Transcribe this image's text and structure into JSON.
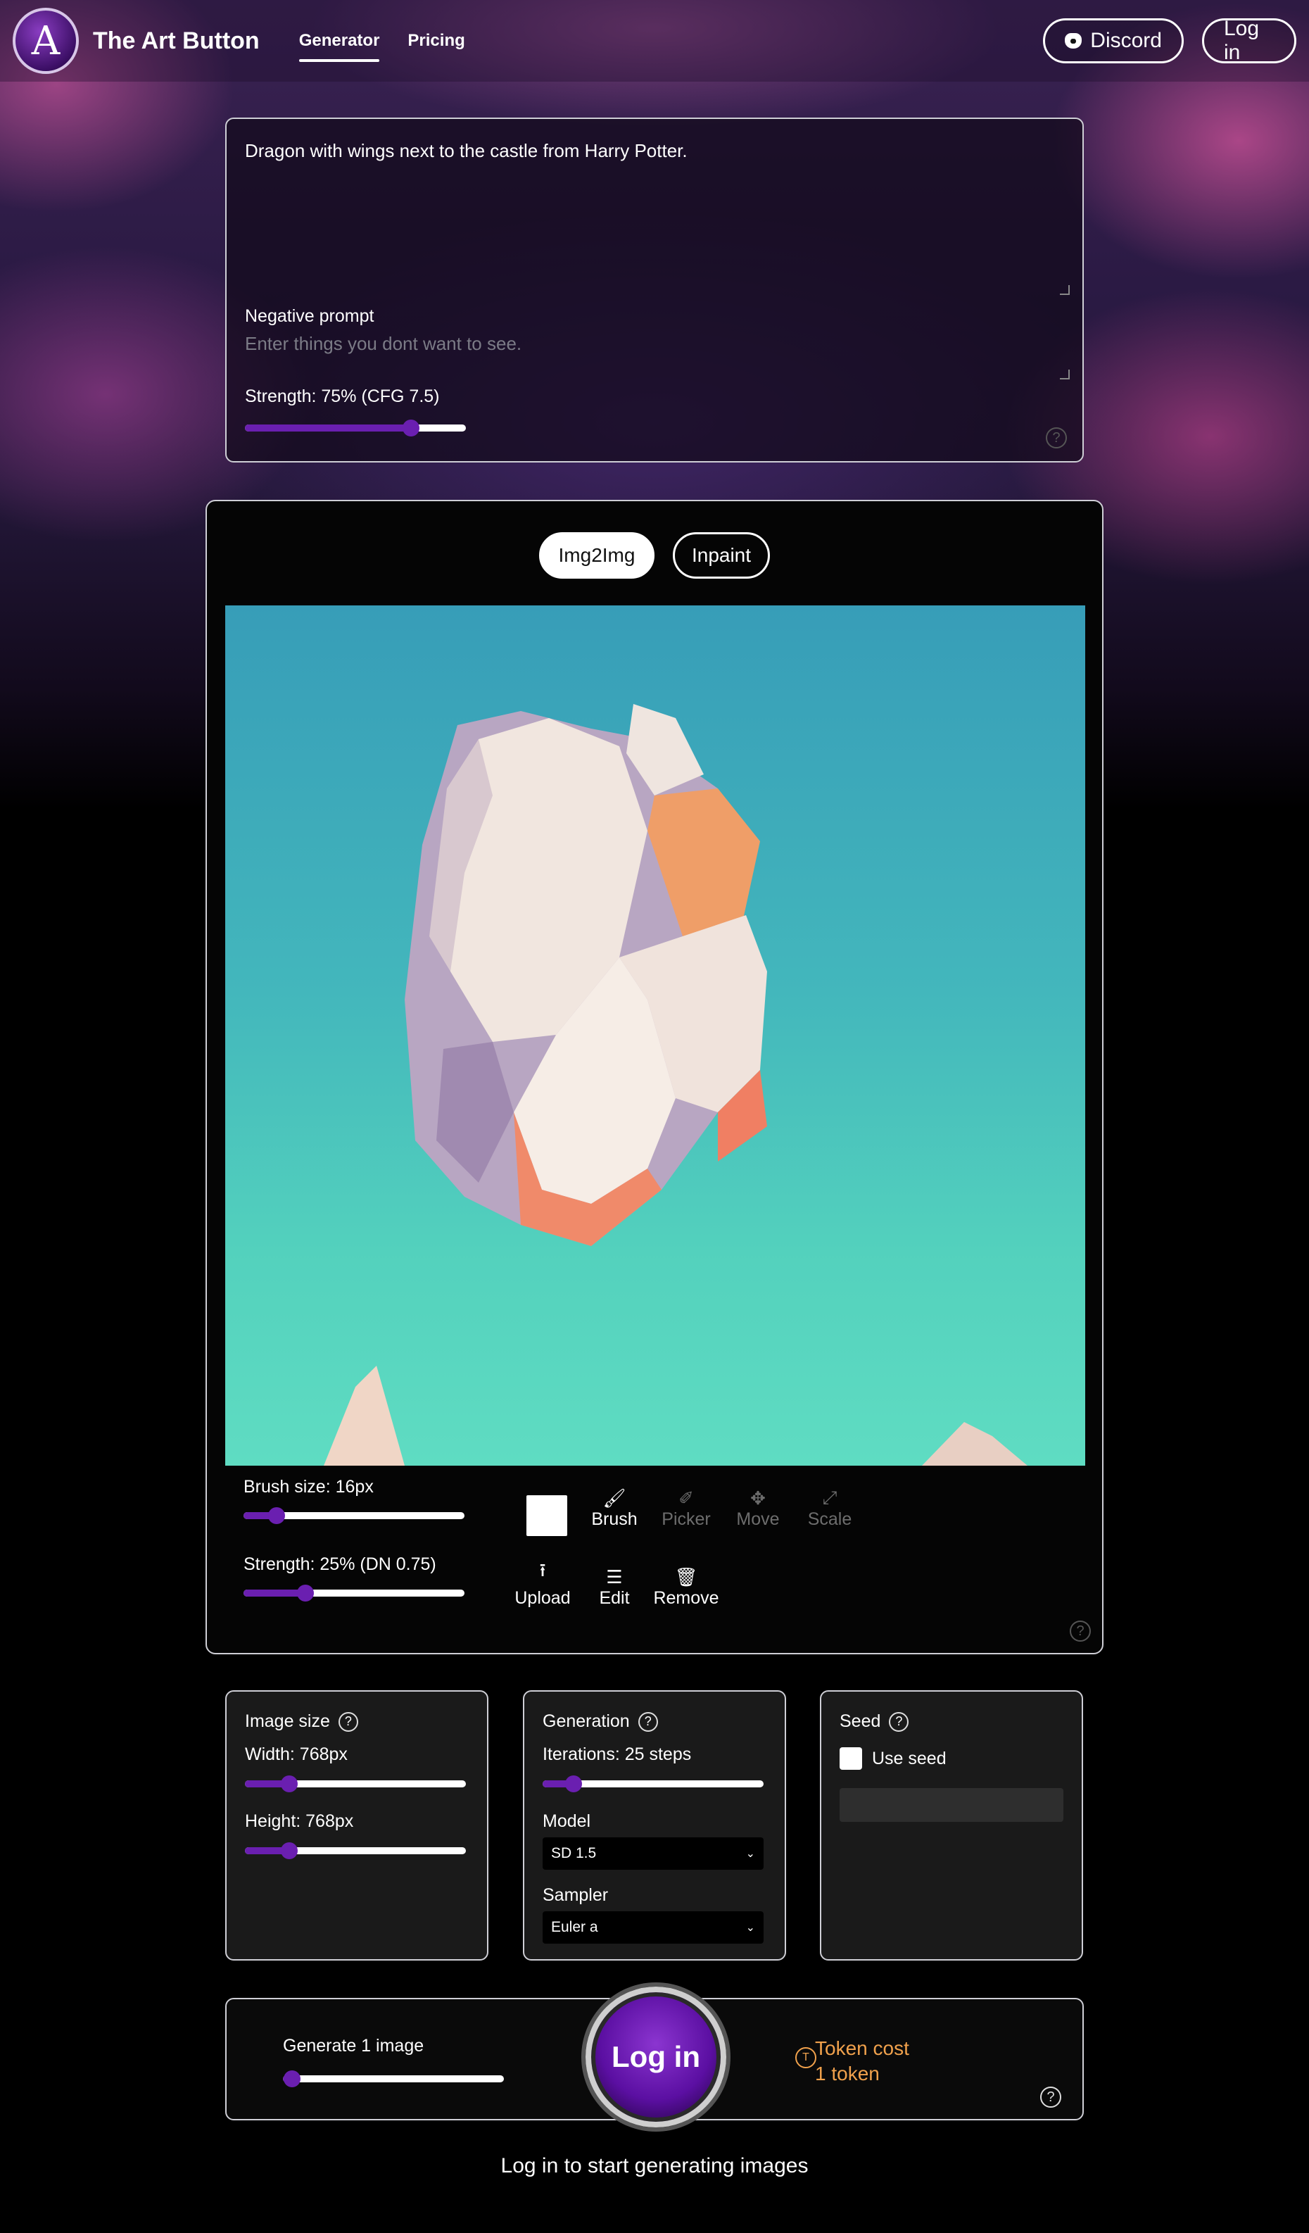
{
  "app": {
    "logo_letter": "A",
    "brand": "The Art Button"
  },
  "nav": {
    "items": [
      {
        "label": "Generator",
        "active": true
      },
      {
        "label": "Pricing",
        "active": false
      }
    ]
  },
  "header_actions": {
    "discord_label": "Discord",
    "login_label": "Log in"
  },
  "prompt": {
    "value": "Dragon with wings next to the castle from Harry Potter.",
    "negative_label": "Negative prompt",
    "negative_placeholder": "Enter things you dont want to see.",
    "strength_label": "Strength: 75% (CFG 7.5)",
    "strength_value": 0.75
  },
  "image_editor": {
    "tabs": [
      {
        "label": "Img2Img",
        "active": true
      },
      {
        "label": "Inpaint",
        "active": false
      }
    ],
    "brush_size_label": "Brush size: 16px",
    "brush_size_value": 0.15,
    "strength_label": "Strength: 25% (DN 0.75)",
    "strength_value": 0.28,
    "brush_color": "#ffffff",
    "tools": [
      {
        "label": "Brush",
        "icon": "brush-icon",
        "active": true
      },
      {
        "label": "Picker",
        "icon": "picker-icon",
        "active": false
      },
      {
        "label": "Move",
        "icon": "move-icon",
        "active": false
      },
      {
        "label": "Scale",
        "icon": "scale-icon",
        "active": false
      }
    ],
    "actions": [
      {
        "label": "Upload",
        "icon": "upload-icon"
      },
      {
        "label": "Edit",
        "icon": "edit-icon"
      },
      {
        "label": "Remove",
        "icon": "trash-icon"
      }
    ]
  },
  "image_size": {
    "title": "Image size",
    "width_label": "Width: 768px",
    "width_value": 0.2,
    "height_label": "Height: 768px",
    "height_value": 0.2
  },
  "generation": {
    "title": "Generation",
    "iterations_label": "Iterations: 25 steps",
    "iterations_value": 0.14,
    "model_label": "Model",
    "model_value": "SD 1.5",
    "sampler_label": "Sampler",
    "sampler_value": "Euler a"
  },
  "seed": {
    "title": "Seed",
    "use_seed_label": "Use seed",
    "use_seed_checked": false
  },
  "generate": {
    "count_label": "Generate 1 image",
    "count_value": 0.04,
    "button_label": "Log in",
    "token_cost_line1": "Token cost",
    "token_cost_line2": "1 token"
  },
  "footer": {
    "note": "Log in to start generating images"
  },
  "colors": {
    "accent": "#6a1fb0",
    "token": "#f0a14c"
  }
}
